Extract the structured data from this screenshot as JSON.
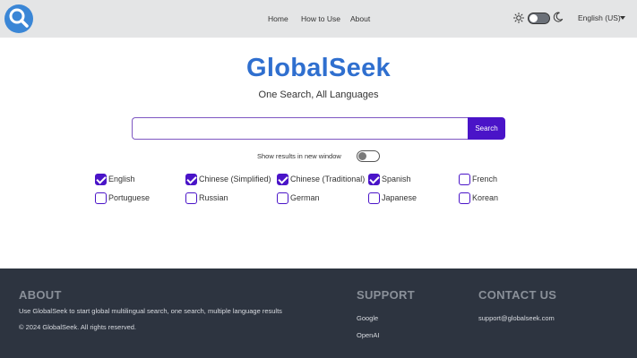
{
  "header": {
    "logo_icon": "magnifier-icon",
    "nav": [
      {
        "label": "Home"
      },
      {
        "label": "How to Use"
      },
      {
        "label": "About"
      }
    ],
    "theme": {
      "light_icon": "sun-icon",
      "dark_icon": "moon-icon",
      "dark_mode": false
    },
    "language_selector": "English (US)"
  },
  "hero": {
    "brand": "GlobalSeek",
    "tagline": "One Search, All Languages"
  },
  "search": {
    "value": "",
    "placeholder": "",
    "button_label": "Search"
  },
  "options": {
    "new_window_label": "Show results in new window",
    "new_window_enabled": false
  },
  "languages": [
    {
      "label": "English",
      "checked": true
    },
    {
      "label": "Chinese (Simplified)",
      "checked": true
    },
    {
      "label": "Chinese (Traditional)",
      "checked": true
    },
    {
      "label": "Spanish",
      "checked": true
    },
    {
      "label": "French",
      "checked": false
    },
    {
      "label": "Portuguese",
      "checked": false
    },
    {
      "label": "Russian",
      "checked": false
    },
    {
      "label": "German",
      "checked": false
    },
    {
      "label": "Japanese",
      "checked": false
    },
    {
      "label": "Korean",
      "checked": false
    }
  ],
  "footer": {
    "about": {
      "heading": "ABOUT",
      "text": "Use GlobalSeek to start global multilingual search, one search, multiple language results",
      "copyright": "© 2024 GlobalSeek. All rights reserved."
    },
    "support": {
      "heading": "SUPPORT",
      "links": [
        "Google",
        "OpenAI"
      ]
    },
    "contact": {
      "heading": "CONTACT US",
      "email": "support@globalseek.com"
    }
  },
  "colors": {
    "header_bg": "#e4e5e6",
    "brand": "#2f6fcf",
    "accent": "#4a14c8",
    "footer_bg": "#2d3440"
  }
}
